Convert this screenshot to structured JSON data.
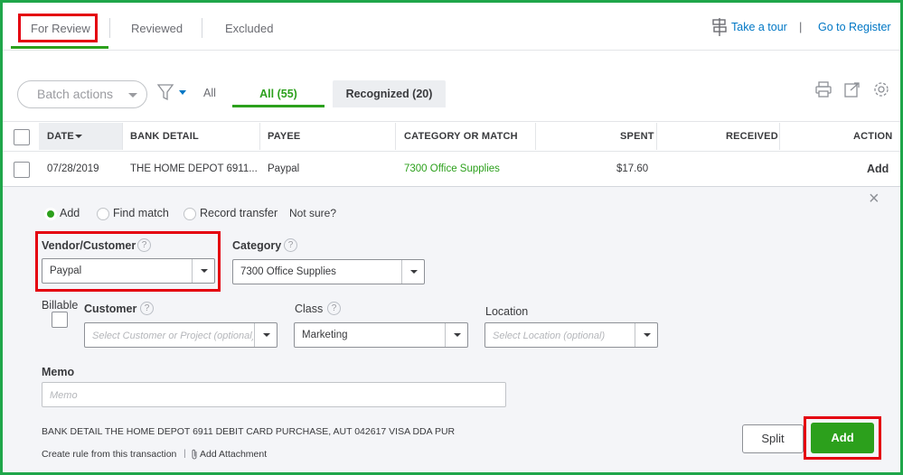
{
  "tabs": {
    "for_review": "For Review",
    "reviewed": "Reviewed",
    "excluded": "Excluded"
  },
  "top_links": {
    "take_tour": "Take a tour",
    "separator": "|",
    "go_to_register": "Go to Register"
  },
  "toolbar": {
    "batch_actions": "Batch actions",
    "filter_all": "All",
    "tab_all": "All (55)",
    "tab_recognized": "Recognized (20)"
  },
  "table": {
    "headers": [
      "DATE",
      "BANK DETAIL",
      "PAYEE",
      "CATEGORY OR MATCH",
      "SPENT",
      "RECEIVED",
      "ACTION"
    ],
    "row": {
      "date": "07/28/2019",
      "bank_detail": "THE HOME DEPOT 6911...",
      "payee": "Paypal",
      "category": "7300 Office Supplies",
      "spent": "$17.60",
      "received": "",
      "action": "Add"
    }
  },
  "detail": {
    "close": "×",
    "mode_add": "Add",
    "mode_find_match": "Find match",
    "mode_record_transfer": "Record transfer",
    "not_sure": "Not sure?",
    "vendor_label": "Vendor/Customer",
    "vendor_value": "Paypal",
    "category_label": "Category",
    "category_value": "7300 Office Supplies",
    "billable_label": "Billable",
    "customer_label": "Customer",
    "customer_placeholder": "Select Customer or Project (optional)",
    "class_label": "Class",
    "class_value": "Marketing",
    "location_label": "Location",
    "location_placeholder": "Select Location (optional)",
    "memo_label": "Memo",
    "memo_placeholder": "Memo",
    "bank_detail_label": "BANK DETAIL",
    "bank_detail_text": "THE HOME DEPOT 6911 DEBIT CARD PURCHASE, AUT 042617 VISA DDA PUR",
    "create_rule": "Create rule from this transaction",
    "link_sep": "|",
    "add_attachment": "Add Attachment",
    "split_button": "Split",
    "add_button": "Add",
    "help_glyph": "?"
  },
  "colors": {
    "green": "#2ca01c",
    "blue": "#0077c5",
    "frame_green": "#1fa64a",
    "annotation_red": "#e4000f"
  }
}
